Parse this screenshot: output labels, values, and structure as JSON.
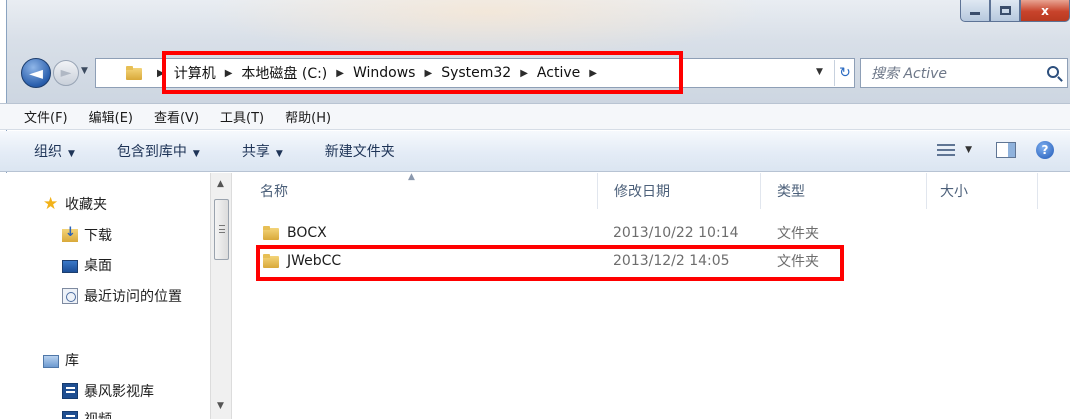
{
  "window": {
    "minimize_label": "",
    "maximize_label": "",
    "close_label": "x"
  },
  "nav": {
    "back_glyph": "◄",
    "forward_glyph": "►"
  },
  "address": {
    "crumbs": [
      "计算机",
      "本地磁盘 (C:)",
      "Windows",
      "System32",
      "Active"
    ],
    "separator": "▶",
    "refresh_glyph": "↻"
  },
  "search": {
    "placeholder": "搜索 Active"
  },
  "menu": {
    "items": [
      "文件(F)",
      "编辑(E)",
      "查看(V)",
      "工具(T)",
      "帮助(H)"
    ]
  },
  "toolbar": {
    "organize": "组织",
    "include_library": "包含到库中",
    "share": "共享",
    "new_folder": "新建文件夹",
    "help_glyph": "?"
  },
  "sidebar": {
    "favorites": "收藏夹",
    "downloads": "下载",
    "desktop": "桌面",
    "recent": "最近访问的位置",
    "libraries": "库",
    "video_lib": "暴风影视库",
    "partial_item": "视频"
  },
  "columns": {
    "name": "名称",
    "date": "修改日期",
    "type": "类型",
    "size": "大小"
  },
  "files": [
    {
      "name": "BOCX",
      "date": "2013/10/22 10:14",
      "type": "文件夹"
    },
    {
      "name": "JWebCC",
      "date": "2013/12/2 14:05",
      "type": "文件夹"
    }
  ],
  "colors": {
    "highlight_box": "#ff0000",
    "accent": "#1e3457"
  }
}
